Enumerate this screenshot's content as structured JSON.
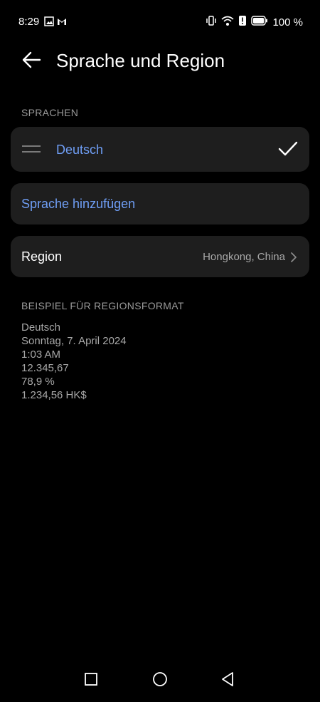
{
  "status_bar": {
    "time": "8:29",
    "battery_percent": "100 %",
    "left_icons": [
      "gallery-notification-icon",
      "gmail-icon"
    ],
    "right_icons": [
      "vibrate-icon",
      "wifi-icon",
      "alert-icon",
      "battery-icon"
    ]
  },
  "header": {
    "title": "Sprache und Region"
  },
  "languages": {
    "section_label": "SPRACHEN",
    "items": [
      {
        "label": "Deutsch",
        "selected": true
      }
    ],
    "add_label": "Sprache hinzufügen"
  },
  "region": {
    "label": "Region",
    "value": "Hongkong, China"
  },
  "format_example": {
    "section_label": "BEISPIEL FÜR REGIONSFORMAT",
    "lines": [
      "Deutsch",
      "Sonntag, 7. April 2024",
      "1:03 AM",
      "12.345,67",
      "78,9 %",
      "1.234,56 HK$"
    ]
  },
  "colors": {
    "background": "#000000",
    "card": "#1e1e1e",
    "accent": "#6f9ef5",
    "secondary_text": "#a8a8a8"
  }
}
